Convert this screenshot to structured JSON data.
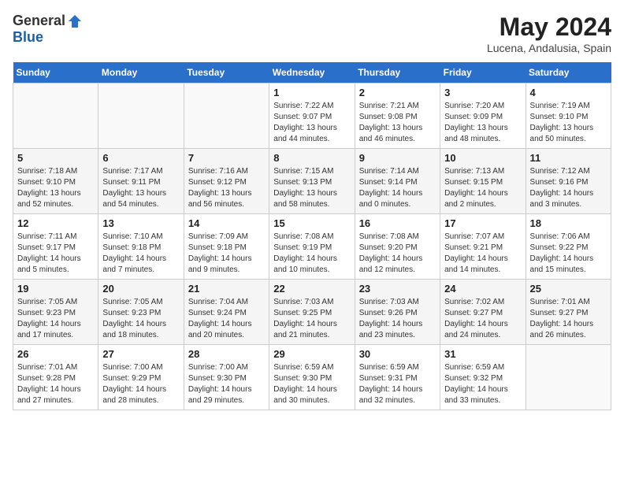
{
  "header": {
    "logo_general": "General",
    "logo_blue": "Blue",
    "month_year": "May 2024",
    "location": "Lucena, Andalusia, Spain"
  },
  "weekdays": [
    "Sunday",
    "Monday",
    "Tuesday",
    "Wednesday",
    "Thursday",
    "Friday",
    "Saturday"
  ],
  "weeks": [
    [
      {
        "day": "",
        "sunrise": "",
        "sunset": "",
        "daylight": ""
      },
      {
        "day": "",
        "sunrise": "",
        "sunset": "",
        "daylight": ""
      },
      {
        "day": "",
        "sunrise": "",
        "sunset": "",
        "daylight": ""
      },
      {
        "day": "1",
        "sunrise": "7:22 AM",
        "sunset": "9:07 PM",
        "daylight": "13 hours and 44 minutes."
      },
      {
        "day": "2",
        "sunrise": "7:21 AM",
        "sunset": "9:08 PM",
        "daylight": "13 hours and 46 minutes."
      },
      {
        "day": "3",
        "sunrise": "7:20 AM",
        "sunset": "9:09 PM",
        "daylight": "13 hours and 48 minutes."
      },
      {
        "day": "4",
        "sunrise": "7:19 AM",
        "sunset": "9:10 PM",
        "daylight": "13 hours and 50 minutes."
      }
    ],
    [
      {
        "day": "5",
        "sunrise": "7:18 AM",
        "sunset": "9:10 PM",
        "daylight": "13 hours and 52 minutes."
      },
      {
        "day": "6",
        "sunrise": "7:17 AM",
        "sunset": "9:11 PM",
        "daylight": "13 hours and 54 minutes."
      },
      {
        "day": "7",
        "sunrise": "7:16 AM",
        "sunset": "9:12 PM",
        "daylight": "13 hours and 56 minutes."
      },
      {
        "day": "8",
        "sunrise": "7:15 AM",
        "sunset": "9:13 PM",
        "daylight": "13 hours and 58 minutes."
      },
      {
        "day": "9",
        "sunrise": "7:14 AM",
        "sunset": "9:14 PM",
        "daylight": "14 hours and 0 minutes."
      },
      {
        "day": "10",
        "sunrise": "7:13 AM",
        "sunset": "9:15 PM",
        "daylight": "14 hours and 2 minutes."
      },
      {
        "day": "11",
        "sunrise": "7:12 AM",
        "sunset": "9:16 PM",
        "daylight": "14 hours and 3 minutes."
      }
    ],
    [
      {
        "day": "12",
        "sunrise": "7:11 AM",
        "sunset": "9:17 PM",
        "daylight": "14 hours and 5 minutes."
      },
      {
        "day": "13",
        "sunrise": "7:10 AM",
        "sunset": "9:18 PM",
        "daylight": "14 hours and 7 minutes."
      },
      {
        "day": "14",
        "sunrise": "7:09 AM",
        "sunset": "9:18 PM",
        "daylight": "14 hours and 9 minutes."
      },
      {
        "day": "15",
        "sunrise": "7:08 AM",
        "sunset": "9:19 PM",
        "daylight": "14 hours and 10 minutes."
      },
      {
        "day": "16",
        "sunrise": "7:08 AM",
        "sunset": "9:20 PM",
        "daylight": "14 hours and 12 minutes."
      },
      {
        "day": "17",
        "sunrise": "7:07 AM",
        "sunset": "9:21 PM",
        "daylight": "14 hours and 14 minutes."
      },
      {
        "day": "18",
        "sunrise": "7:06 AM",
        "sunset": "9:22 PM",
        "daylight": "14 hours and 15 minutes."
      }
    ],
    [
      {
        "day": "19",
        "sunrise": "7:05 AM",
        "sunset": "9:23 PM",
        "daylight": "14 hours and 17 minutes."
      },
      {
        "day": "20",
        "sunrise": "7:05 AM",
        "sunset": "9:23 PM",
        "daylight": "14 hours and 18 minutes."
      },
      {
        "day": "21",
        "sunrise": "7:04 AM",
        "sunset": "9:24 PM",
        "daylight": "14 hours and 20 minutes."
      },
      {
        "day": "22",
        "sunrise": "7:03 AM",
        "sunset": "9:25 PM",
        "daylight": "14 hours and 21 minutes."
      },
      {
        "day": "23",
        "sunrise": "7:03 AM",
        "sunset": "9:26 PM",
        "daylight": "14 hours and 23 minutes."
      },
      {
        "day": "24",
        "sunrise": "7:02 AM",
        "sunset": "9:27 PM",
        "daylight": "14 hours and 24 minutes."
      },
      {
        "day": "25",
        "sunrise": "7:01 AM",
        "sunset": "9:27 PM",
        "daylight": "14 hours and 26 minutes."
      }
    ],
    [
      {
        "day": "26",
        "sunrise": "7:01 AM",
        "sunset": "9:28 PM",
        "daylight": "14 hours and 27 minutes."
      },
      {
        "day": "27",
        "sunrise": "7:00 AM",
        "sunset": "9:29 PM",
        "daylight": "14 hours and 28 minutes."
      },
      {
        "day": "28",
        "sunrise": "7:00 AM",
        "sunset": "9:30 PM",
        "daylight": "14 hours and 29 minutes."
      },
      {
        "day": "29",
        "sunrise": "6:59 AM",
        "sunset": "9:30 PM",
        "daylight": "14 hours and 30 minutes."
      },
      {
        "day": "30",
        "sunrise": "6:59 AM",
        "sunset": "9:31 PM",
        "daylight": "14 hours and 32 minutes."
      },
      {
        "day": "31",
        "sunrise": "6:59 AM",
        "sunset": "9:32 PM",
        "daylight": "14 hours and 33 minutes."
      },
      {
        "day": "",
        "sunrise": "",
        "sunset": "",
        "daylight": ""
      }
    ]
  ]
}
